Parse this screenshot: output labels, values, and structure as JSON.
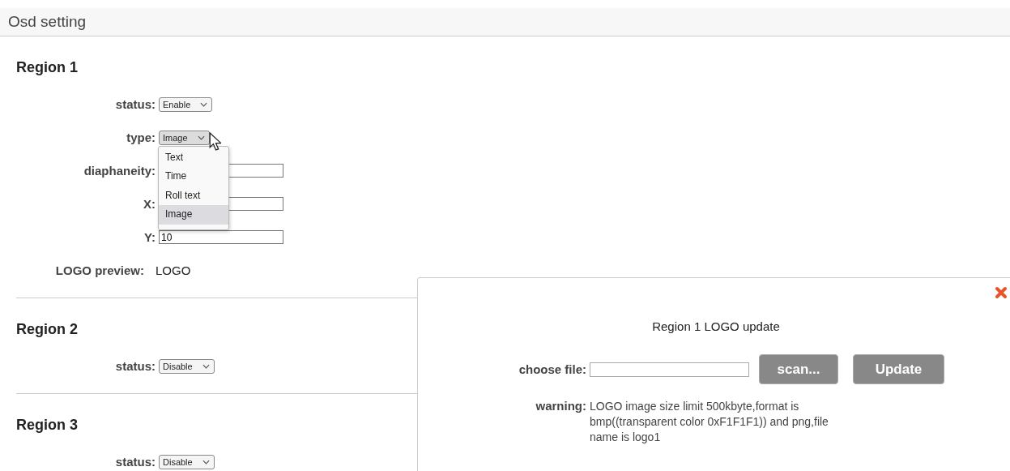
{
  "header": {
    "title": "Osd setting"
  },
  "regions": [
    {
      "title": "Region 1",
      "fields": [
        {
          "kind": "select",
          "label": "status:",
          "value": "Enable"
        },
        {
          "kind": "select",
          "label": "type:",
          "value": "Image",
          "expanded": true,
          "options": [
            {
              "label": "Text",
              "selected": false
            },
            {
              "label": "Time",
              "selected": false
            },
            {
              "label": "Roll text",
              "selected": false
            },
            {
              "label": "Image",
              "selected": true
            }
          ]
        },
        {
          "kind": "input",
          "label": "diaphaneity:"
        },
        {
          "kind": "input",
          "label": "X:"
        },
        {
          "kind": "input",
          "label": "Y:",
          "value": "10"
        },
        {
          "kind": "preview",
          "label": "LOGO preview:",
          "value": "LOGO"
        }
      ]
    },
    {
      "title": "Region 2",
      "fields": [
        {
          "kind": "select",
          "label": "status:",
          "value": "Disable"
        }
      ]
    },
    {
      "title": "Region 3",
      "fields": [
        {
          "kind": "select",
          "label": "status:",
          "value": "Disable"
        }
      ]
    }
  ],
  "dialog": {
    "title": "Region 1 LOGO update",
    "file_label": "choose file:",
    "buttons": [
      "scan...",
      "Update"
    ],
    "warning_label": "warning:",
    "warning": "LOGO image size limit 500kbyte,format is bmp((transparent color 0xF1F1F1)) and png,file name is logo1"
  }
}
